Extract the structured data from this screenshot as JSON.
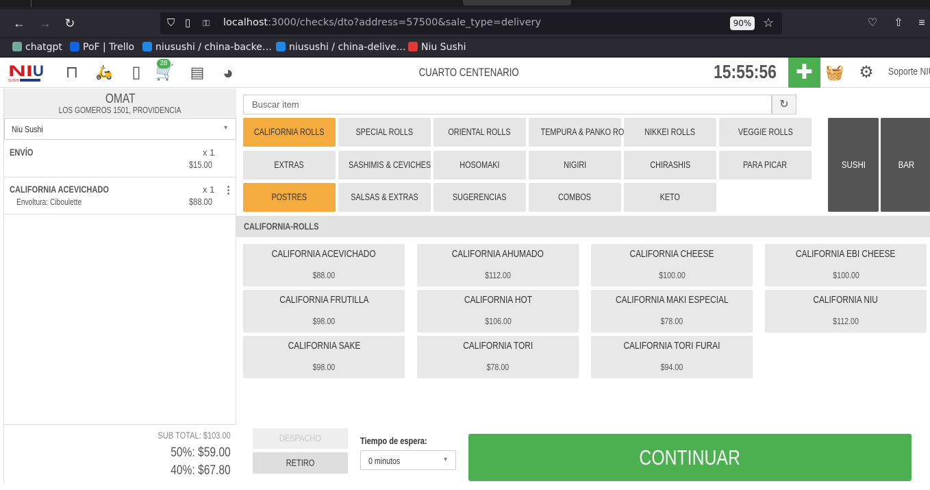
{
  "browser": {
    "url_host": "localhost",
    "url_rest": ":3000/checks/dto?address=57500&sale_type=delivery",
    "zoom": "90%",
    "bookmarks": [
      {
        "label": "chatgpt",
        "color": "#74aa9c"
      },
      {
        "label": "PoF | Trello",
        "color": "#0c66e4"
      },
      {
        "label": "niusushi / china-backe…",
        "color": "#1e88e5"
      },
      {
        "label": "niusushi / china-delive…",
        "color": "#1e88e5"
      },
      {
        "label": "Niu Sushi",
        "color": "#e53935"
      }
    ]
  },
  "header": {
    "cart_count": "28",
    "store": "CUARTO CENTENARIO",
    "clock": "15:55:56",
    "support": "Soporte NIU"
  },
  "customer": {
    "name": "OMAT",
    "address": "LOS GOMEROS 1501, PROVIDENCIA",
    "store_select": "Niu Sushi"
  },
  "order": {
    "items": [
      {
        "name": "ENVÍO",
        "detail": "",
        "qty": "x 1",
        "price": "$15.00"
      },
      {
        "name": "CALIFORNIA ACEVICHADO",
        "detail": "Envoltura: Ciboulette",
        "qty": "x 1",
        "price": "$88.00"
      }
    ],
    "subtotal": "SUB TOTAL: $103.00",
    "discount50": "50%: $59.00",
    "discount40": "40%: $67.80"
  },
  "search": {
    "placeholder": "Buscar item"
  },
  "categories": [
    "CALIFORNIA ROLLS",
    "SPECIAL ROLLS",
    "ORIENTAL ROLLS",
    "TEMPURA & PANKO ROLLS",
    "NIKKEI ROLLS",
    "VEGGIE ROLLS",
    "EXTRAS",
    "SASHIMIS & CEVICHES",
    "HOSOMAKI",
    "NIGIRI",
    "CHIRASHIS",
    "PARA PICAR",
    "POSTRES",
    "SALSAS & EXTRAS",
    "SUGERENCIAS",
    "COMBOS",
    "KETO"
  ],
  "active_categories": [
    "CALIFORNIA ROLLS",
    "POSTRES"
  ],
  "menu_types": [
    "SUSHI",
    "BAR"
  ],
  "section": "CALIFORNIA-ROLLS",
  "products": [
    {
      "name": "CALIFORNIA ACEVICHADO",
      "price": "$88.00"
    },
    {
      "name": "CALIFORNIA AHUMADO",
      "price": "$112.00"
    },
    {
      "name": "CALIFORNIA CHEESE",
      "price": "$100.00"
    },
    {
      "name": "CALIFORNIA EBI CHEESE",
      "price": "$100.00"
    },
    {
      "name": "CALIFORNIA FRUTILLA",
      "price": "$98.00"
    },
    {
      "name": "CALIFORNIA HOT",
      "price": "$106.00"
    },
    {
      "name": "CALIFORNIA MAKI ESPECIAL",
      "price": "$78.00"
    },
    {
      "name": "CALIFORNIA NIU",
      "price": "$112.00"
    },
    {
      "name": "CALIFORNIA SAKE",
      "price": "$98.00"
    },
    {
      "name": "CALIFORNIA TORI",
      "price": "$78.00"
    },
    {
      "name": "CALIFORNIA TORI FURAI",
      "price": "$94.00"
    }
  ],
  "bottom": {
    "despacho": "DESPACHO",
    "retiro": "RETIRO",
    "wait_label": "Tiempo de espera:",
    "wait_value": "0 minutos",
    "continue": "CONTINUAR"
  },
  "colors": {
    "accent_green": "#4caf50",
    "active_orange": "#f5ac3f",
    "dark_type": "#545454",
    "brand_red": "#d71920",
    "brand_blue": "#1f3d8a"
  }
}
